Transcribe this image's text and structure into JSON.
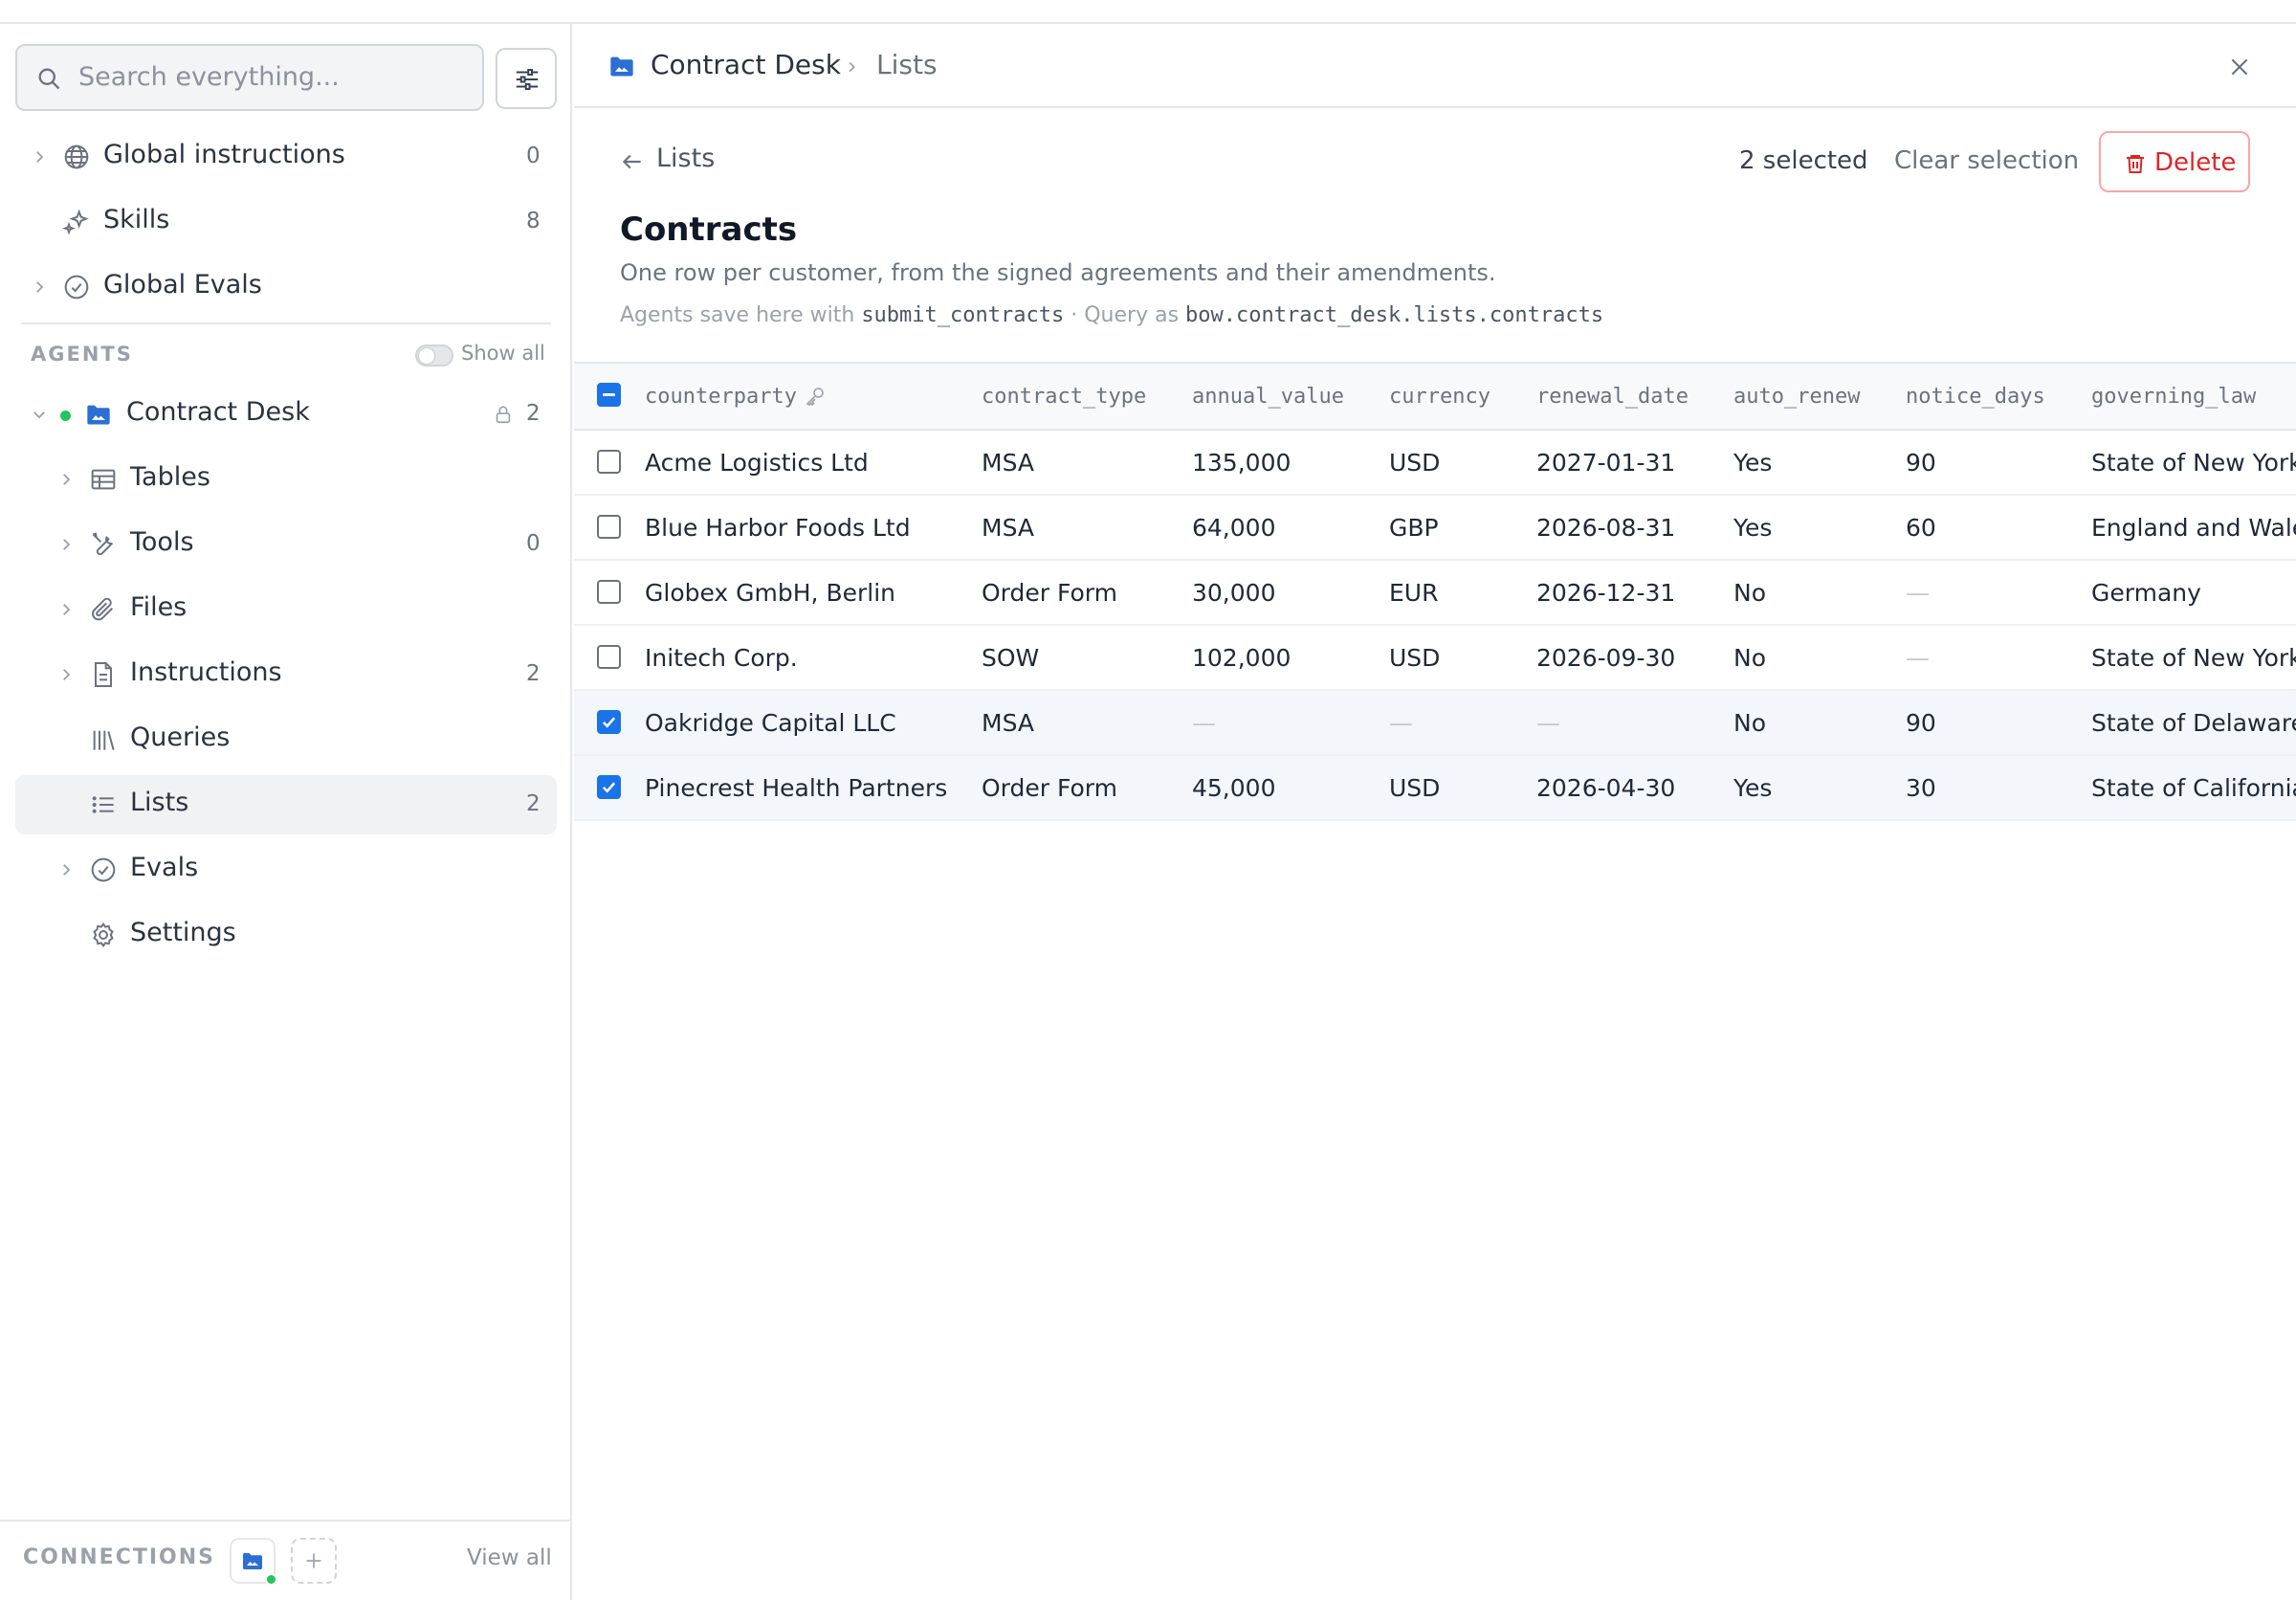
{
  "search": {
    "placeholder": "Search everything..."
  },
  "sidebar": {
    "global_items": [
      {
        "label": "Global instructions",
        "count": "0"
      },
      {
        "label": "Skills",
        "count": "8"
      },
      {
        "label": "Global Evals",
        "count": ""
      }
    ],
    "agents_header": "AGENTS",
    "show_all_label": "Show all",
    "agent": {
      "name": "Contract Desk",
      "count": "2",
      "status_color": "#22c55e"
    },
    "agent_items": [
      {
        "label": "Tables",
        "count": ""
      },
      {
        "label": "Tools",
        "count": "0"
      },
      {
        "label": "Files",
        "count": ""
      },
      {
        "label": "Instructions",
        "count": "2"
      },
      {
        "label": "Queries",
        "count": ""
      },
      {
        "label": "Lists",
        "count": "2"
      },
      {
        "label": "Evals",
        "count": ""
      },
      {
        "label": "Settings",
        "count": ""
      }
    ],
    "connections_label": "CONNECTIONS",
    "view_all_label": "View all"
  },
  "breadcrumb": {
    "app": "Contract Desk",
    "page": "Lists"
  },
  "header": {
    "back_label": "Lists",
    "selected_text": "2 selected",
    "clear_label": "Clear selection",
    "delete_label": "Delete"
  },
  "list": {
    "title": "Contracts",
    "description": "One row per customer, from the signed agreements and their amendments.",
    "meta_prefix": "Agents save here with",
    "tool_name": "submit_contracts",
    "meta_sep": "·",
    "query_prefix": "Query as",
    "query_path": "bow.contract_desk.lists.contracts"
  },
  "table": {
    "columns": [
      "counterparty",
      "contract_type",
      "annual_value",
      "currency",
      "renewal_date",
      "auto_renew",
      "notice_days",
      "governing_law"
    ],
    "rows": [
      {
        "selected": false,
        "cells": [
          "Acme Logistics Ltd",
          "MSA",
          "135,000",
          "USD",
          "2027-01-31",
          "Yes",
          "90",
          "State of New York"
        ]
      },
      {
        "selected": false,
        "cells": [
          "Blue Harbor Foods Ltd",
          "MSA",
          "64,000",
          "GBP",
          "2026-08-31",
          "Yes",
          "60",
          "England and Wale"
        ]
      },
      {
        "selected": false,
        "cells": [
          "Globex GmbH, Berlin",
          "Order Form",
          "30,000",
          "EUR",
          "2026-12-31",
          "No",
          "—",
          "Germany"
        ]
      },
      {
        "selected": false,
        "cells": [
          "Initech Corp.",
          "SOW",
          "102,000",
          "USD",
          "2026-09-30",
          "No",
          "—",
          "State of New York"
        ]
      },
      {
        "selected": true,
        "cells": [
          "Oakridge Capital LLC",
          "MSA",
          "—",
          "—",
          "—",
          "No",
          "90",
          "State of Delaware"
        ]
      },
      {
        "selected": true,
        "cells": [
          "Pinecrest Health Partners",
          "Order Form",
          "45,000",
          "USD",
          "2026-04-30",
          "Yes",
          "30",
          "State of California"
        ]
      }
    ]
  },
  "colors": {
    "accent": "#1a73e8",
    "danger": "#dc2626",
    "status_green": "#22c55e"
  }
}
